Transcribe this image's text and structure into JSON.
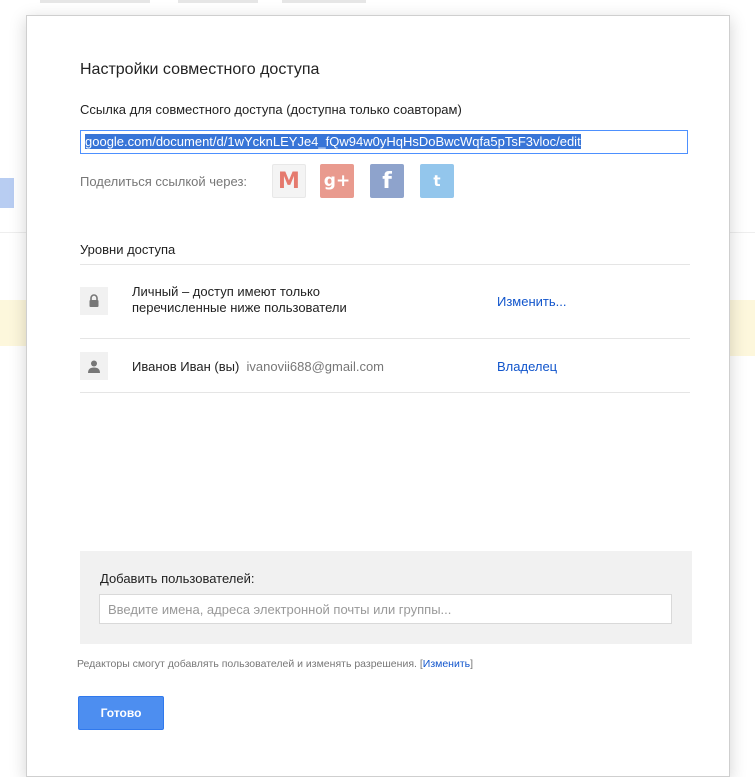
{
  "dialog": {
    "title": "Настройки совместного доступа",
    "link_label": "Ссылка для совместного доступа (доступна только соавторам)",
    "link_value": "google.com/document/d/1wYcknLEYJe4_fQw94w0yHqHsDoBwcWqfa5pTsF3vloc/edit",
    "share_via_label": "Поделиться ссылкой через:",
    "share_services": [
      {
        "name": "Gmail",
        "glyph": "M",
        "icon": "gmail-icon",
        "color": "#e57a6e"
      },
      {
        "name": "Google+",
        "glyph": "g+",
        "icon": "google-plus-icon",
        "color": "#e99a8e"
      },
      {
        "name": "Facebook",
        "glyph": "f",
        "icon": "facebook-icon",
        "color": "#8ea3cc"
      },
      {
        "name": "Twitter",
        "glyph": "t",
        "icon": "twitter-icon",
        "color": "#93c6ec"
      }
    ],
    "access_levels_title": "Уровни доступа",
    "access_rows": [
      {
        "icon": "lock-icon",
        "text": "Личный – доступ имеют только перечисленные ниже пользователи",
        "action": "Изменить..."
      },
      {
        "icon": "person-icon",
        "name": "Иванов Иван (вы)",
        "email": "ivanovii688@gmail.com",
        "role": "Владелец"
      }
    ],
    "add_users": {
      "label": "Добавить пользователей:",
      "placeholder": "Введите имена, адреса электронной почты или группы...",
      "value": ""
    },
    "note": {
      "text": "Редакторы смогут добавлять пользователей и изменять разрешения.",
      "link_open": " [",
      "link": "Изменить",
      "link_close": "]"
    },
    "done_button": "Готово"
  },
  "colors": {
    "link_blue": "#1155cc",
    "button_blue": "#4d8ef0",
    "selection_blue": "#3875d7"
  }
}
